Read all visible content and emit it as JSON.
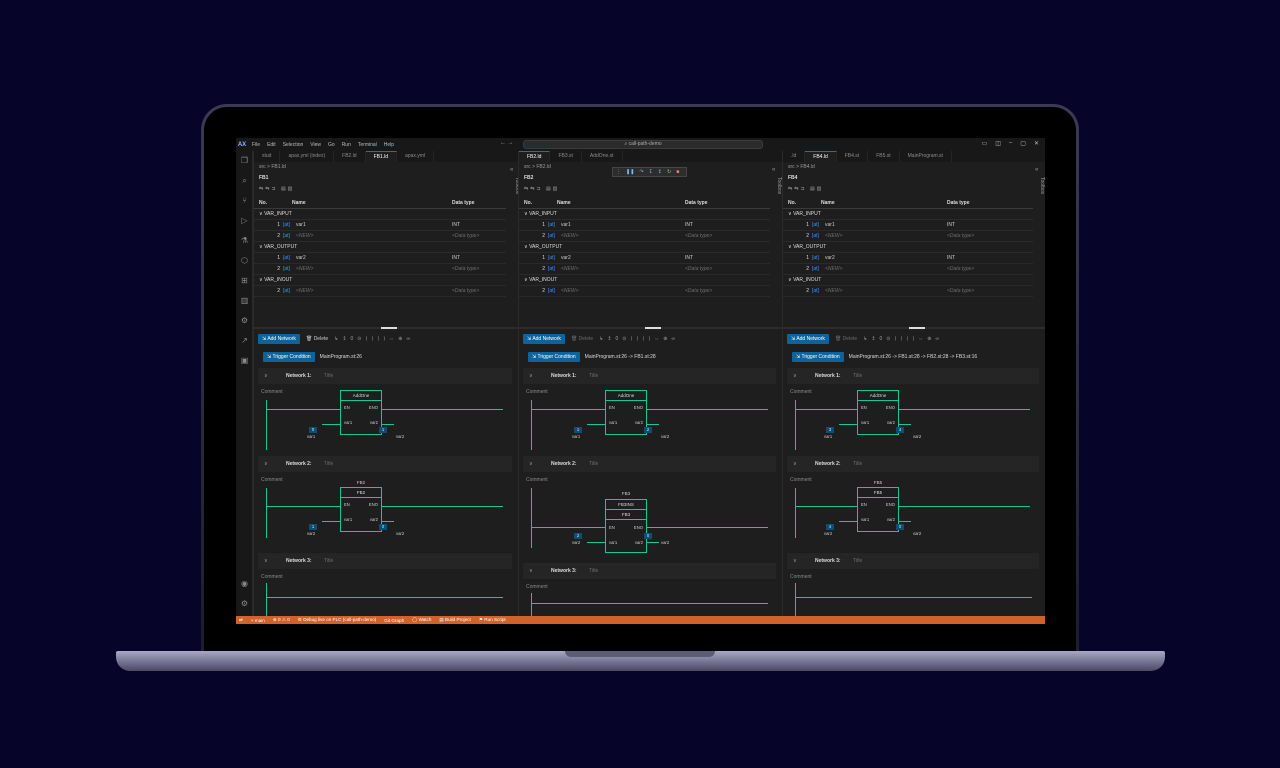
{
  "app": {
    "logo": "AX",
    "menu": [
      "File",
      "Edit",
      "Selection",
      "View",
      "Go",
      "Run",
      "Terminal",
      "Help"
    ],
    "command_center": "call-path-demo",
    "nav_arrows": "← →"
  },
  "statusbar": {
    "branch": "main",
    "problems": "⊗ 0 ⚠ 0",
    "debug": "Debug live on PLC (call-path-demo)",
    "git_graph": "Git Graph",
    "watch": "Watch",
    "build": "Build Project",
    "run_script": "Run Script"
  },
  "toolbox_label": "Toolbox",
  "var_table": {
    "col_no": "No.",
    "col_name": "Name",
    "col_type": "Data type",
    "sections": [
      "VAR_INPUT",
      "VAR_OUTPUT",
      "VAR_INOUT"
    ],
    "rows": [
      {
        "idx": "1",
        "at": "[at]",
        "name": "var1",
        "type": "INT"
      },
      {
        "idx": "2",
        "at": "[at]",
        "name": "<NEW>",
        "type": "<Data type>"
      },
      {
        "idx": "1",
        "at": "[at]",
        "name": "var2",
        "type": "INT"
      },
      {
        "idx": "2",
        "at": "[at]",
        "name": "<NEW>",
        "type": "<Data type>"
      },
      {
        "idx": "2",
        "at": "[at]",
        "name": "<NEW>",
        "type": "<Data type>"
      }
    ]
  },
  "toolbar": {
    "add_network": "Add Network",
    "delete": "Delete",
    "trigger": "Trigger Condition",
    "comment": "Comment",
    "title_placeholder": "Title"
  },
  "panes": [
    {
      "tabs": [
        "stud",
        "apax.yml (index)",
        "FB2.ld",
        "FB1.ld",
        "apax.yml"
      ],
      "active_tab": 3,
      "breadcrumb": "src > FB1.ld",
      "fb_title": "FB1",
      "trigger_path": "MainProgram.st:26",
      "networks": [
        {
          "label": "Network 1:",
          "block": "AddOne",
          "instance": "",
          "in_val": "0",
          "out_val": "1"
        },
        {
          "label": "Network 2:",
          "block": "FB2",
          "instance": "FB2",
          "in_val": "1",
          "out_val": "0"
        },
        {
          "label": "Network 3:"
        }
      ]
    },
    {
      "tabs": [
        "FB2.ld",
        "FB3.st",
        "AddOne.st"
      ],
      "active_tab": 0,
      "breadcrumb": "src > FB2.ld",
      "fb_title": "FB2",
      "trigger_path": "MainProgram.st:26 -> FB1.st:28",
      "networks": [
        {
          "label": "Network 1:",
          "block": "AddOne",
          "instance": "",
          "in_val": "1",
          "out_val": "2"
        },
        {
          "label": "Network 2:",
          "block": "FB3",
          "instance": "FB3",
          "header2": "FB3INS",
          "in_val": "2",
          "out_val": "0"
        },
        {
          "label": "Network 3:"
        }
      ]
    },
    {
      "tabs": [
        ".ld",
        "FB4.ld",
        "FB4.st",
        "FB5.st",
        "MainProgram.st"
      ],
      "active_tab": 1,
      "breadcrumb": "src > FB4.ld",
      "fb_title": "FB4",
      "trigger_path": "MainProgram.st:26 -> FB1.st:28 -> FB2.st:28 -> FB3.st:16",
      "networks": [
        {
          "label": "Network 1:",
          "block": "AddOne",
          "instance": "",
          "in_val": "3",
          "out_val": "4"
        },
        {
          "label": "Network 2:",
          "block": "FB5",
          "instance": "FB5",
          "in_val": "4",
          "out_val": "0"
        },
        {
          "label": "Network 3:"
        }
      ]
    }
  ],
  "pins": {
    "en": "EN",
    "eno": "ENO",
    "var1": "var1",
    "var2": "var2"
  },
  "colors": {
    "rail": "#16c79a",
    "status": "#d2622b",
    "accent": "#0e639c",
    "background": "#07042a"
  }
}
